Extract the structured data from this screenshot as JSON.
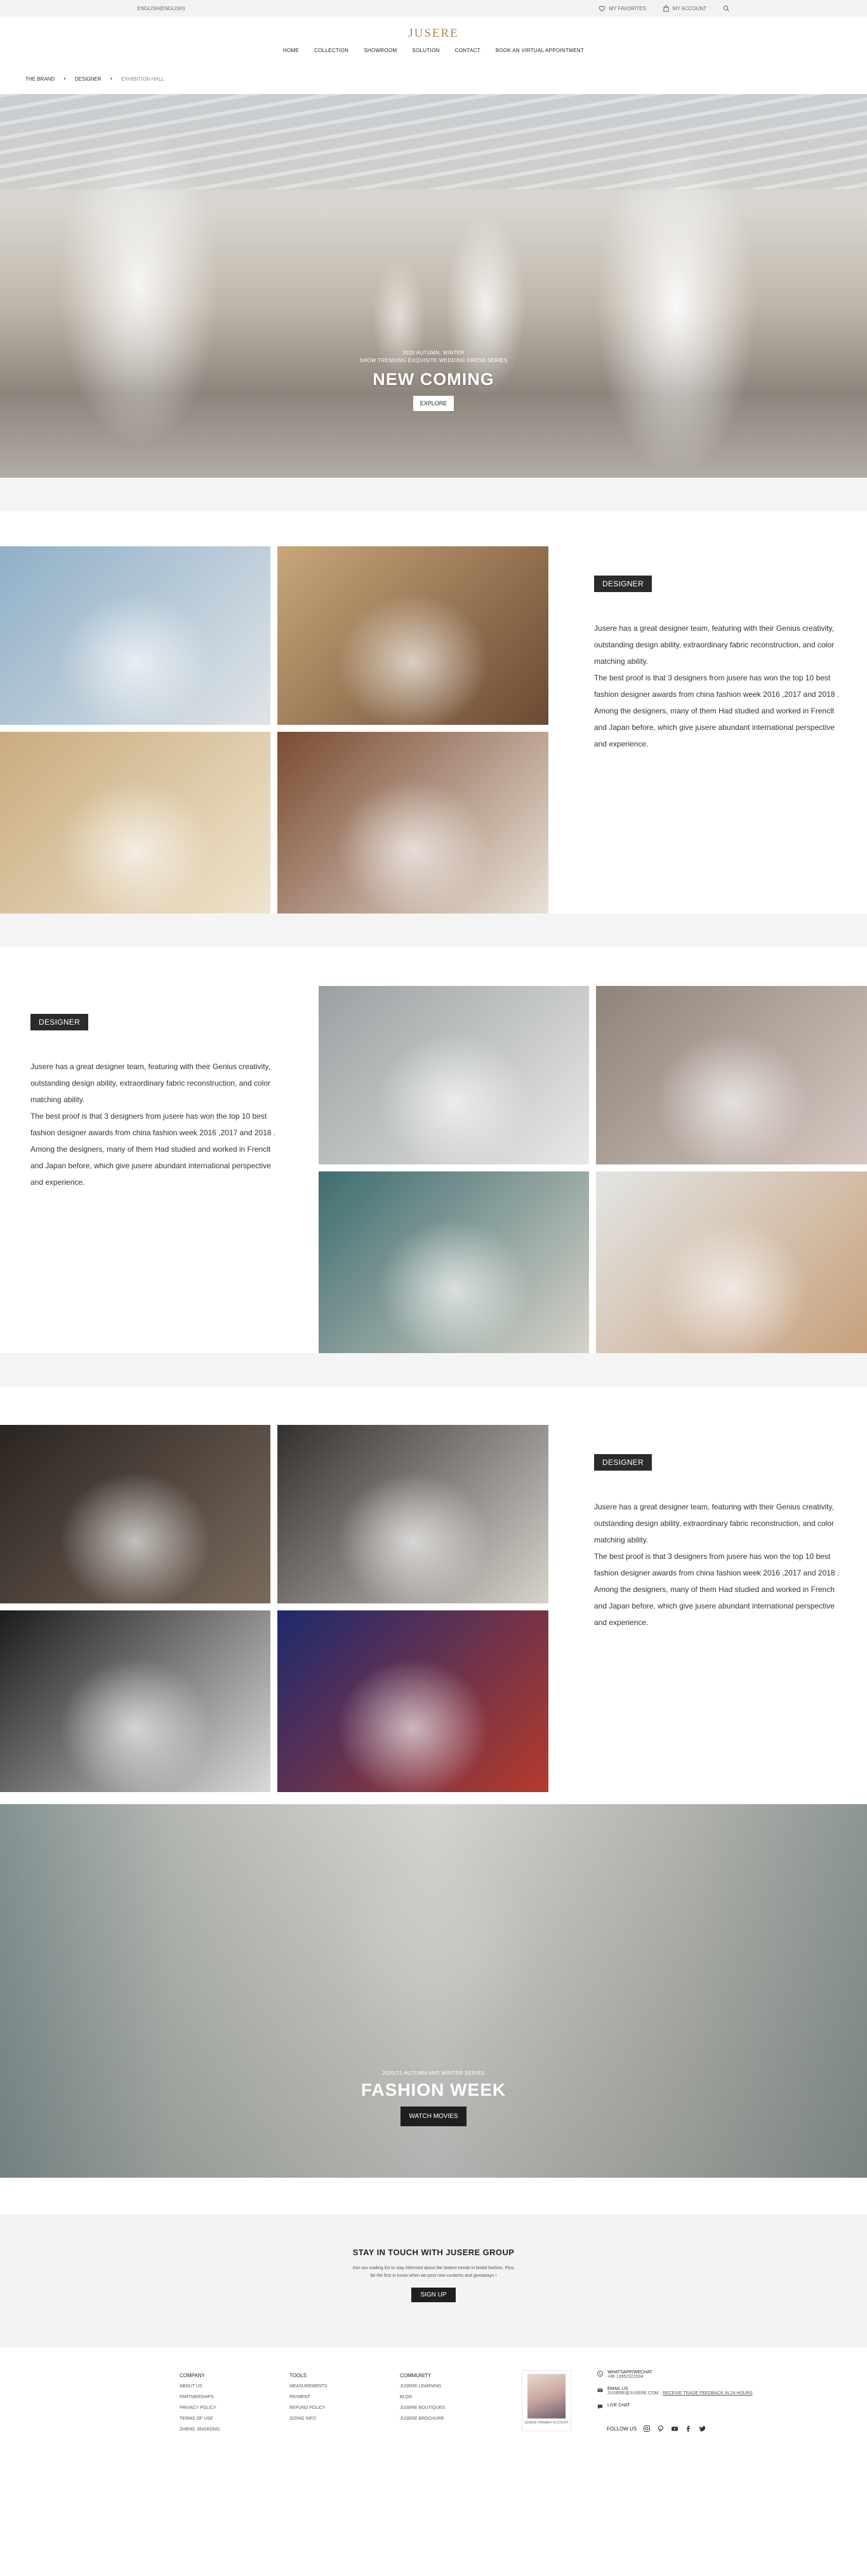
{
  "topbar": {
    "left_text": "ENGLISH(ENGLISH)",
    "favorites_label": "MY FAVORITES",
    "account_label": "MY ACCOUNT",
    "icons": [
      "heart-icon",
      "bag-icon",
      "search-icon"
    ]
  },
  "header": {
    "logo": "JUSERE",
    "nav": [
      "HOME",
      "COLLECTION",
      "SHOWROOM",
      "SOLUTION",
      "CONTACT",
      "BOOK AN VIRTUAL APPOINTMENT"
    ]
  },
  "breadcrumb": {
    "items": [
      "THE BRAND",
      "DESIGNER",
      "EXHIBITION HALL"
    ]
  },
  "hero": {
    "sub_line_1": "2020 AUTUMN, WINTER",
    "sub_line_2": "SHOW TRENDING EXQUISITE WEDDING DRESS SERIES",
    "title": "NEW COMING",
    "button": "EXPLORE",
    "slides_count": 3,
    "active_slide": 2
  },
  "sections": [
    {
      "tag": "DESIGNER",
      "paragraphs": [
        "Jusere has a great designer team, featuring with their Genius creativity, outstanding design ability, extraordinary fabric reconstruction, and color matching ability.",
        "The best proof is that 3 designers from jusere has won the top 10 best fashion designer awards from china fashion week 2016 ,2017 and 2018 .",
        "Among the designers, many of them Had studied and worked in Frenclt and Japan before, which give jusere abundant international perspective and experience."
      ],
      "photo_colors": [
        [
          "#8fb0c8",
          "#dfe3e6"
        ],
        [
          "#c9a77a",
          "#6a4a33"
        ],
        [
          "#c9ac7f",
          "#efe3cc"
        ],
        [
          "#7a4b32",
          "#e9e1d6"
        ]
      ]
    },
    {
      "tag": "DESIGNER",
      "paragraphs": [
        "Jusere has a great designer team, featuring with their Genius creativity, outstanding design ability, extraordinary fabric reconstruction, and color matching ability.",
        "The best proof is that 3 designers from jusere has won the top 10 best fashion designer awards from china fashion week 2016 ,2017 and 2018 .",
        "Among the designers, many of them Had studied and worked in Frenclt and Japan before, which give jusere abundant international perspective and experience."
      ],
      "photo_colors": [
        [
          "#9aa0a2",
          "#e8e8e6"
        ],
        [
          "#8e8478",
          "#d7c7c2"
        ],
        [
          "#3e6d70",
          "#d6d2c8"
        ],
        [
          "#e3e5e4",
          "#c7a17c"
        ]
      ]
    },
    {
      "tag": "DESIGNER",
      "paragraphs": [
        "Jusere has a great designer team, featuring with their Genius creativity, outstanding design ability, extraordinary fabric reconstruction, and color matching ability.",
        "The best proof is that 3 designers from jusere has won the top 10 best fashion designer awards from china fashion week 2016 ,2017 and 2018 .",
        "Among the designers, many of them Had studied and worked in French and Japan before, which give jusere abundant international perspective and experience."
      ],
      "photo_colors": [
        [
          "#2a2420",
          "#7a6a5c"
        ],
        [
          "#33302e",
          "#d8d2cc"
        ],
        [
          "#1c1c1c",
          "#d9d9d9"
        ],
        [
          "#1d2a6e",
          "#b53a2c"
        ]
      ]
    }
  ],
  "fashion_week": {
    "sub": "2020/21 AUTUMN AND WINTER SERIES",
    "title": "FASHION WEEK",
    "button": "WATCH MOVIES"
  },
  "newsletter": {
    "title": "STAY IN TOUCH WITH JUSERE GROUP",
    "line_1": "Join our mailing list to stay informed about the lastest trends in bridal fashion. Plus,",
    "line_2": "be the first to know when we post new contents and giveaways !",
    "button": "SIGN UP"
  },
  "footer": {
    "company": {
      "heading": "COMPANY",
      "items": [
        "ABOUT US",
        "PARTNERSHIPS",
        "PRIVACY POLICY",
        "TERMS OF USE",
        "ZHENG JINGRONG"
      ]
    },
    "tools": {
      "heading": "TOOLS",
      "items": [
        "MEASUREMENTS",
        "PAYMENT",
        "REFUND POLICY",
        "SIZING INFO"
      ]
    },
    "community": {
      "heading": "COMMUNITY",
      "items": [
        "JUSERE LEARNING",
        "BLOG",
        "JUSERE BOUTIQUES",
        "JUSERE BROCHURE"
      ]
    },
    "qr_caption": "JUSERE PRIMARY ACCOUNT",
    "whatsapp_label": "WHATSAPP/WECHAT",
    "whatsapp_number": "+86 13952321594",
    "email_label": "EMAIL US",
    "email_value": "JUSERE@JUSERE.COM",
    "email_note": "RECEIVE TRADE FEEDBACK IN 24 HOURS",
    "chat_label": "LIVE CHAT",
    "follow_label": "FOLLOW US",
    "social": [
      "instagram-icon",
      "pinterest-icon",
      "youtube-icon",
      "facebook-icon",
      "twitter-icon"
    ]
  }
}
